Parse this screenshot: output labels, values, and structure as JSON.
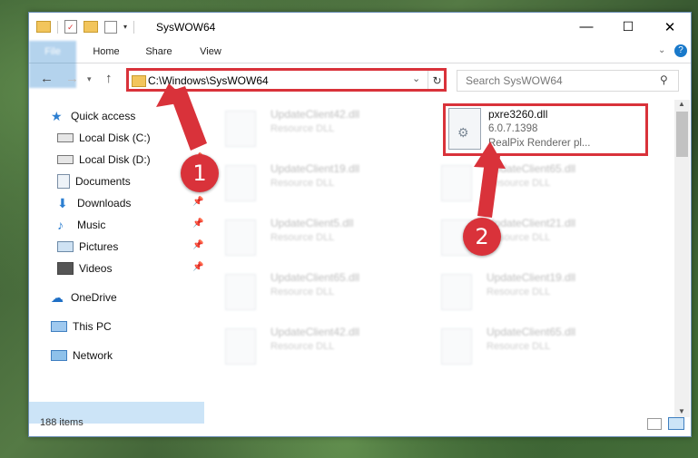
{
  "window": {
    "title": "SysWOW64",
    "controls": {
      "minimize": "—",
      "maximize": "☐",
      "close": "✕"
    },
    "ribbon_tabs": [
      "File",
      "Home",
      "Share",
      "View"
    ],
    "help": "?"
  },
  "address": {
    "path": "C:\\Windows\\SysWOW64"
  },
  "search": {
    "placeholder": "Search SysWOW64"
  },
  "sidebar": {
    "items": [
      {
        "label": "Quick access"
      },
      {
        "label": "Local Disk (C:)"
      },
      {
        "label": "Local Disk (D:)"
      },
      {
        "label": "Documents"
      },
      {
        "label": "Downloads"
      },
      {
        "label": "Music"
      },
      {
        "label": "Pictures"
      },
      {
        "label": "Videos"
      },
      {
        "label": "OneDrive"
      },
      {
        "label": "This PC"
      },
      {
        "label": "Network"
      }
    ]
  },
  "files": [
    {
      "name": "UpdateClient42.dll",
      "desc": "Resource DLL"
    },
    {
      "name": "UpdateClient19.dll",
      "desc": "Resource DLL"
    },
    {
      "name": "UpdateClient65.dll",
      "desc": "Resource DLL"
    },
    {
      "name": "UpdateClient5.dll",
      "desc": "Resource DLL"
    },
    {
      "name": "UpdateClient21.dll",
      "desc": "Resource DLL"
    },
    {
      "name": "UpdateClient65.dll",
      "desc": "Resource DLL"
    },
    {
      "name": "UpdateClient19.dll",
      "desc": "Resource DLL"
    },
    {
      "name": "UpdateClient42.dll",
      "desc": "Resource DLL"
    },
    {
      "name": "UpdateClient65.dll",
      "desc": "Resource DLL"
    }
  ],
  "selected_file": {
    "name": "pxre3260.dll",
    "version": "6.0.7.1398",
    "description": "RealPix Renderer pl..."
  },
  "status": {
    "item_count": "188 items"
  },
  "annotations": {
    "step1": "1",
    "step2": "2",
    "color": "#d9323a"
  }
}
